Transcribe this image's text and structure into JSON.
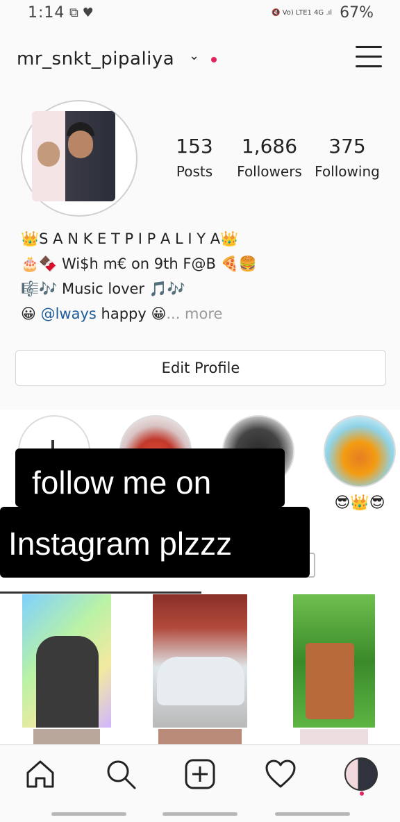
{
  "status_bar": {
    "time": "1:14",
    "left_icons": "⧉ ♥",
    "right_icons": "🔇 Vo) LTE1 4G .ıl",
    "battery": "67%"
  },
  "header": {
    "username": "mr_snkt_pipaliya",
    "chevron": "⌄"
  },
  "stats": {
    "posts": {
      "value": "153",
      "label": "Posts"
    },
    "followers": {
      "value": "1,686",
      "label": "Followers"
    },
    "following": {
      "value": "375",
      "label": "Following"
    }
  },
  "bio": {
    "line1": "👑S A N K E T P I P A L I Y A👑",
    "line2": "🎂🍫 Wi$h m€ on 9th F@B 🍕🍔",
    "line3": "🎼🎶 Music lover 🎵🎶",
    "line4_emoji": "😀",
    "line4_mention": "@lways",
    "line4_text": " happy 😀",
    "more": "... more"
  },
  "edit_profile_label": "Edit Profile",
  "highlights": {
    "label_3": "😎👑😎"
  },
  "captions": {
    "line1": "follow me on",
    "line2": "Instagram plzzz"
  },
  "icons": {
    "home": "home-icon",
    "search": "search-icon",
    "add": "add-icon",
    "heart": "heart-icon",
    "profile": "profile-icon"
  },
  "colors": {
    "accent_red": "#e0245e",
    "mention_blue": "#1d5b9a"
  }
}
